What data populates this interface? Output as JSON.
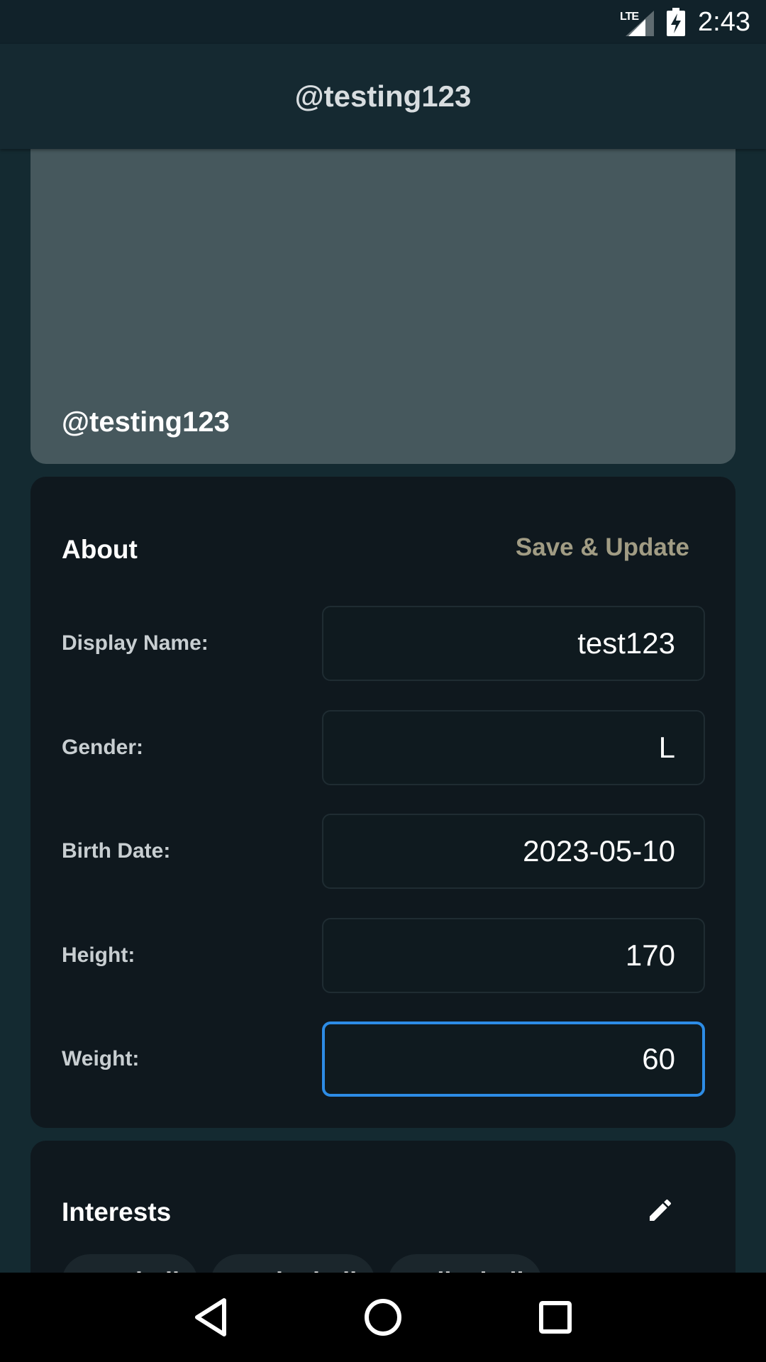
{
  "status_bar": {
    "network": "LTE",
    "time": "2:43"
  },
  "app_bar": {
    "title": "@testing123"
  },
  "cover": {
    "handle": "@testing123"
  },
  "about": {
    "title": "About",
    "save_label": "Save & Update",
    "fields": [
      {
        "label": "Display Name:",
        "value": "test123"
      },
      {
        "label": "Gender:",
        "value": "L"
      },
      {
        "label": "Birth Date:",
        "value": "2023-05-10"
      },
      {
        "label": "Height:",
        "value": "170"
      },
      {
        "label": "Weight:",
        "value": "60"
      }
    ]
  },
  "interests": {
    "title": "Interests",
    "edit_icon": "pencil-icon",
    "chips": [
      "Football",
      "Basketball",
      "Volleyball"
    ]
  },
  "nav_bar": {
    "back_icon": "back-triangle-icon",
    "home_icon": "home-circle-icon",
    "recents_icon": "recents-square-icon"
  },
  "colors": {
    "background": "#142a31",
    "card": "#0f181e",
    "cover": "#46585d",
    "accent_text": "#a19c84",
    "focus_border": "#2d8ce6"
  }
}
